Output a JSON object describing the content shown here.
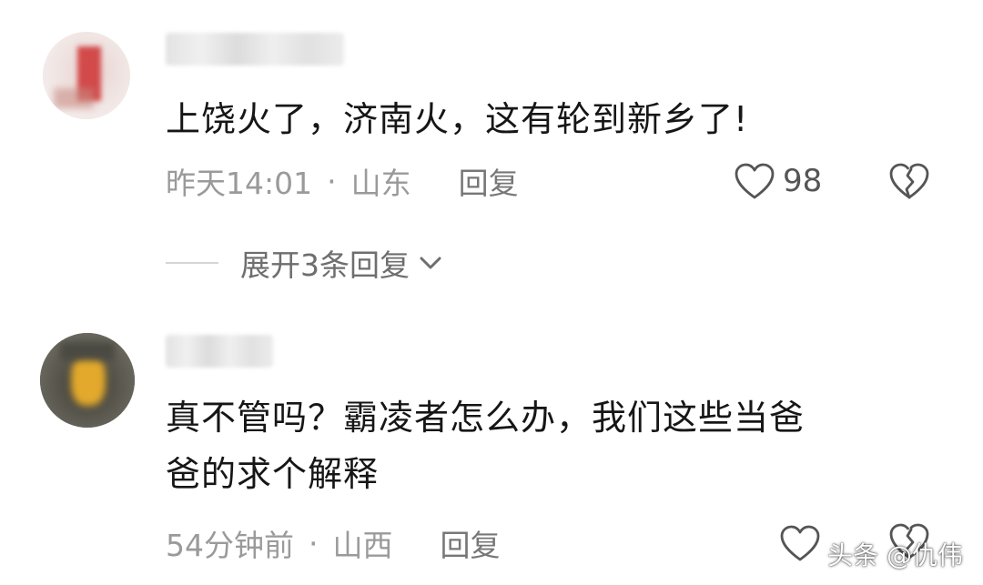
{
  "comments": [
    {
      "content": "上饶火了，济南火，这有轮到新乡了!",
      "time": "昨天14:01",
      "location": "山东",
      "reply_label": "回复",
      "likes": "98",
      "expand_label": "展开3条回复"
    },
    {
      "content_line1": "真不管吗？霸凌者怎么办，我们这些当爸",
      "content_line2": "爸的求个解释",
      "time": "54分钟前",
      "location": "山西",
      "reply_label": "回复"
    }
  ],
  "separator": "·",
  "watermark": "头条 @仇伟",
  "icons": {
    "like": "heart-outline-icon",
    "dislike": "broken-heart-icon",
    "expand": "chevron-down-icon"
  },
  "colors": {
    "text": "#161616",
    "meta": "#9a9a9a",
    "icon": "#555555"
  }
}
